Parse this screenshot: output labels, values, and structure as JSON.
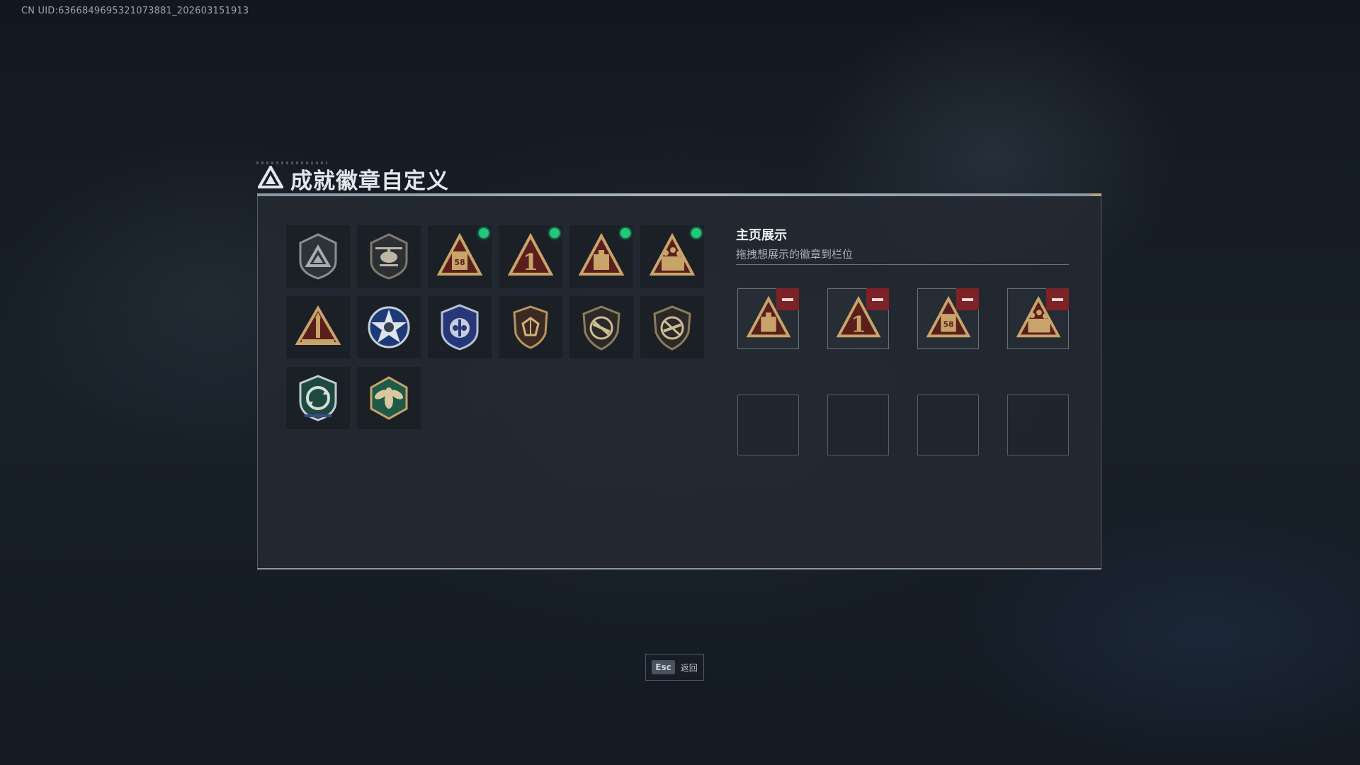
{
  "header": {
    "uid_text": "CN UID:6366849695321073881_202603151913"
  },
  "title": {
    "text": "成就徽章自定义",
    "icon": "triangle-logo-icon"
  },
  "badges": [
    {
      "name": "badge-shield-triangle",
      "icon": "shield-triangle-icon",
      "new": false
    },
    {
      "name": "badge-helicopter-shield",
      "icon": "helicopter-shield-icon",
      "new": false
    },
    {
      "name": "badge-triangle-58",
      "icon": "triangle-58-icon",
      "new": true
    },
    {
      "name": "badge-triangle-1",
      "icon": "triangle-number-one-icon",
      "new": true
    },
    {
      "name": "badge-triangle-crate",
      "icon": "triangle-crate-icon",
      "new": true
    },
    {
      "name": "badge-triangle-soldiers",
      "icon": "triangle-soldiers-icon",
      "new": true
    },
    {
      "name": "badge-triangle-rocket",
      "icon": "triangle-rocket-icon",
      "new": false
    },
    {
      "name": "badge-star-skull",
      "icon": "star-skull-icon",
      "new": false
    },
    {
      "name": "badge-blue-emblem",
      "icon": "blue-emblem-icon",
      "new": false
    },
    {
      "name": "badge-gem-shield",
      "icon": "gem-shield-icon",
      "new": false
    },
    {
      "name": "badge-no-rifle-shield",
      "icon": "no-rifle-shield-icon",
      "new": false
    },
    {
      "name": "badge-no-rifle-shield-2",
      "icon": "no-rifle-shield-icon",
      "new": false
    },
    {
      "name": "badge-recycle-shield",
      "icon": "recycle-shield-icon",
      "new": false
    },
    {
      "name": "badge-wasp-hexagon",
      "icon": "wasp-hexagon-icon",
      "new": false
    }
  ],
  "display": {
    "title": "主页展示",
    "subtitle": "拖拽想展示的徽章到栏位",
    "slots": [
      {
        "badge": "triangle-crate-icon",
        "filled": true
      },
      {
        "badge": "triangle-number-one-icon",
        "filled": true
      },
      {
        "badge": "triangle-58-icon",
        "filled": true
      },
      {
        "badge": "triangle-soldiers-icon",
        "filled": true
      },
      {
        "badge": "",
        "filled": false
      },
      {
        "badge": "",
        "filled": false
      },
      {
        "badge": "",
        "filled": false
      },
      {
        "badge": "",
        "filled": false
      }
    ],
    "remove_icon": "minus-icon"
  },
  "footer": {
    "esc_key": "Esc",
    "back_label": "返回"
  },
  "colors": {
    "accent_gold": "#c8a46a",
    "new_dot": "#20c97a",
    "remove_red": "#7d2226",
    "panel_bg": "#242a32"
  }
}
